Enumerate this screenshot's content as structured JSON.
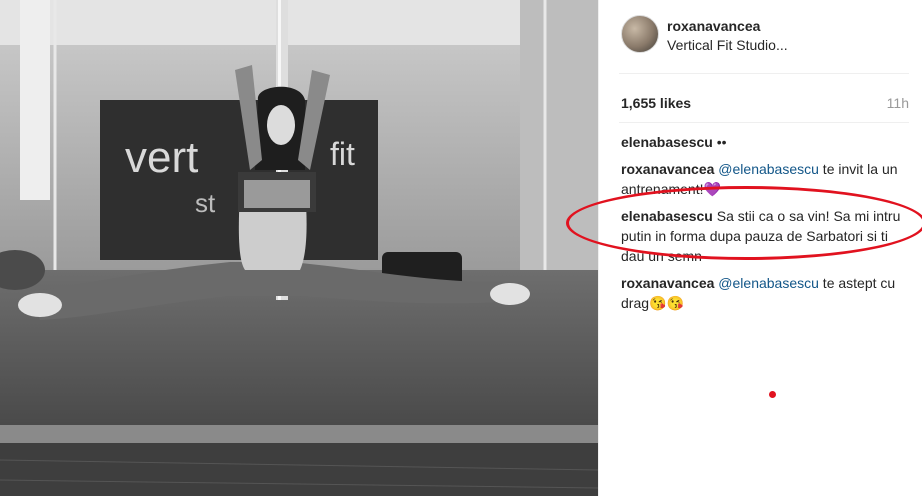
{
  "post": {
    "username": "roxanavancea",
    "location": "Vertical Fit Studio...",
    "likes": "1,655 likes",
    "time": "11h"
  },
  "photo": {
    "sign_left": "vert",
    "sign_right": "fit",
    "sign_bottom": "st"
  },
  "comments": [
    {
      "user": "elenabasescu",
      "text": "••"
    },
    {
      "user": "roxanavancea",
      "mention": "@elenabasescu",
      "text": " te invit la un antrenament!💜"
    },
    {
      "user": "elenabasescu",
      "text": "Sa stii ca o sa vin! Sa mi intru putin in forma dupa pauza de Sarbatori si ti dau un semn"
    },
    {
      "user": "roxanavancea",
      "mention": "@elenabasescu",
      "text": " te astept cu drag😘😘"
    }
  ],
  "colors": {
    "highlight": "#e1121f",
    "mention": "#125688"
  }
}
